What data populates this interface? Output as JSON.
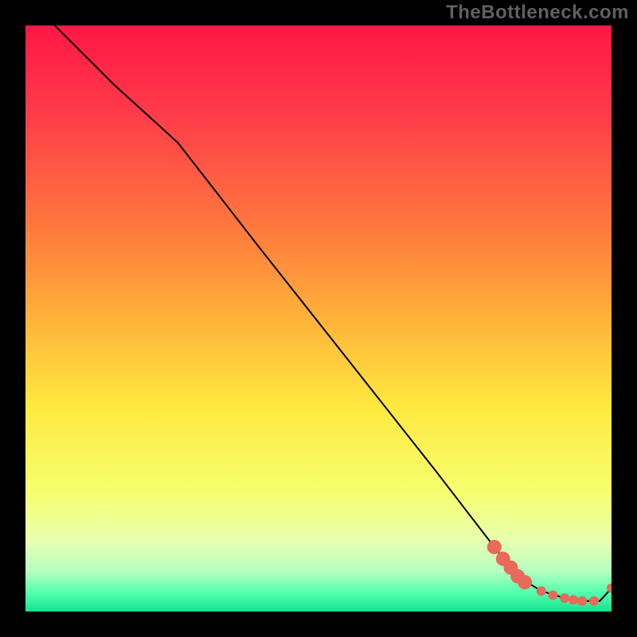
{
  "watermark": "TheBottleneck.com",
  "chart_data": {
    "type": "line",
    "title": "",
    "xlabel": "",
    "ylabel": "",
    "xlim": [
      0,
      100
    ],
    "ylim": [
      0,
      100
    ],
    "background_gradient": {
      "orientation": "vertical",
      "stops": [
        {
          "offset": 0.0,
          "color": "#ff1744"
        },
        {
          "offset": 0.15,
          "color": "#ff3b4a"
        },
        {
          "offset": 0.35,
          "color": "#ff7a3d"
        },
        {
          "offset": 0.5,
          "color": "#ffb23a"
        },
        {
          "offset": 0.65,
          "color": "#ffe93f"
        },
        {
          "offset": 0.8,
          "color": "#f6ff70"
        },
        {
          "offset": 0.88,
          "color": "#e7ffb0"
        },
        {
          "offset": 0.93,
          "color": "#b7ffc0"
        },
        {
          "offset": 0.97,
          "color": "#4dffad"
        },
        {
          "offset": 1.0,
          "color": "#18e090"
        }
      ]
    },
    "series": [
      {
        "name": "curve",
        "stroke": "#000000",
        "stroke_width": 2,
        "x": [
          5,
          15,
          26,
          40,
          55,
          70,
          80,
          84,
          88,
          92,
          95,
          98,
          100
        ],
        "y": [
          100,
          90,
          80,
          62,
          43,
          24,
          11,
          6,
          3.5,
          2.3,
          1.8,
          1.8,
          4
        ]
      }
    ],
    "markers": {
      "name": "bottom-markers",
      "color": "#e86a5a",
      "radius_large": 9,
      "radius_small": 6,
      "points": [
        {
          "x": 80.0,
          "y": 11.0,
          "r": 9
        },
        {
          "x": 81.5,
          "y": 9.0,
          "r": 9
        },
        {
          "x": 82.8,
          "y": 7.5,
          "r": 9
        },
        {
          "x": 84.0,
          "y": 6.0,
          "r": 9
        },
        {
          "x": 85.2,
          "y": 5.0,
          "r": 9
        },
        {
          "x": 88.0,
          "y": 3.5,
          "r": 6
        },
        {
          "x": 90.0,
          "y": 2.8,
          "r": 6
        },
        {
          "x": 92.0,
          "y": 2.3,
          "r": 6
        },
        {
          "x": 93.5,
          "y": 2.0,
          "r": 6
        },
        {
          "x": 95.0,
          "y": 1.8,
          "r": 6
        },
        {
          "x": 97.0,
          "y": 1.8,
          "r": 6
        },
        {
          "x": 100.0,
          "y": 4.0,
          "r": 6
        }
      ]
    }
  }
}
